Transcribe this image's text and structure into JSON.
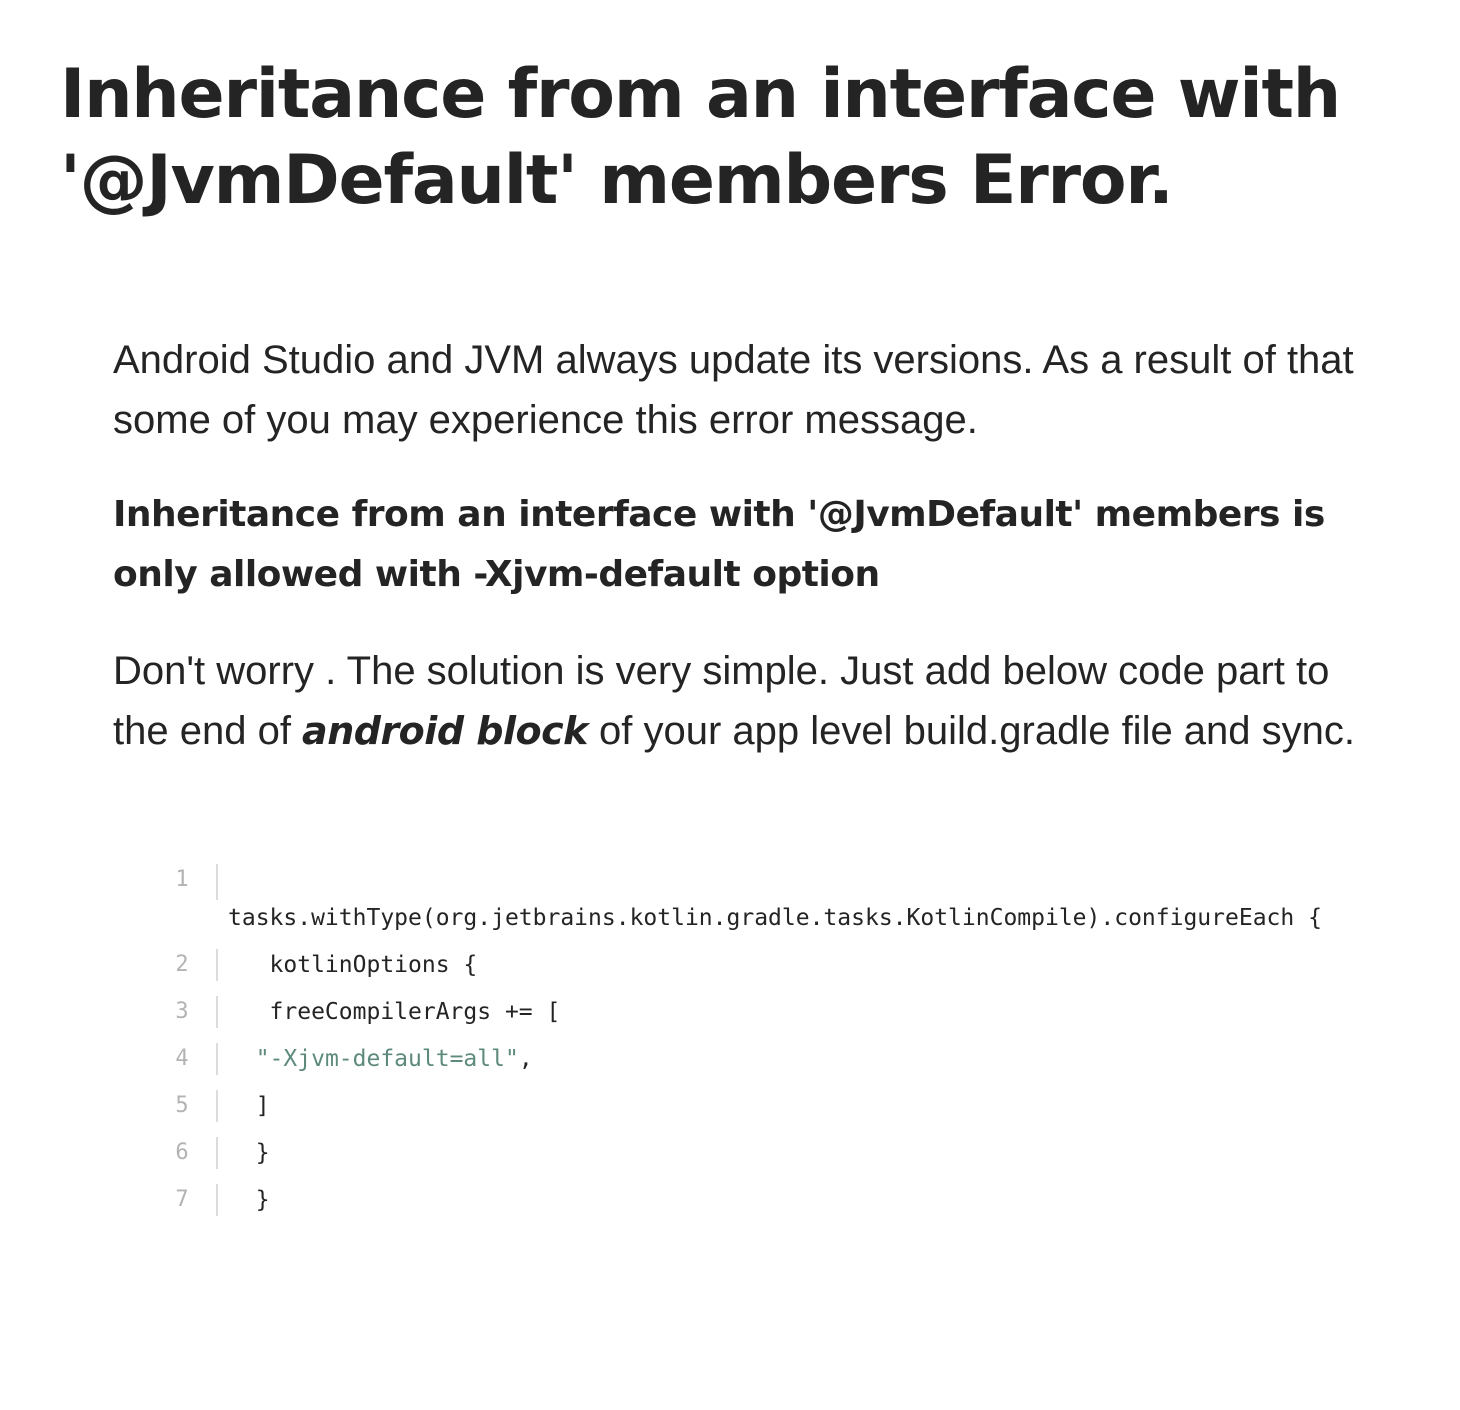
{
  "article": {
    "title": "Inheritance from an interface with '@JvmDefault' members Error.",
    "paragraphs": {
      "intro": "Android Studio and JVM always update its versions. As a result of that some of you may experience this error message.",
      "error_message": "Inheritance from an interface with '@JvmDefault' members is only allowed with -Xjvm-default option",
      "solution_part1": "Don't worry . The solution is very simple. Just add below code part to the end of ",
      "solution_emphasis": "android block",
      "solution_part2": " of your app level build.gradle file and sync."
    }
  },
  "code": {
    "lines": [
      {
        "num": "1",
        "text": "tasks.withType(org.jetbrains.kotlin.gradle.tasks.KotlinCompile).configureEach {"
      },
      {
        "num": "2",
        "text": "   kotlinOptions {"
      },
      {
        "num": "3",
        "text": "   freeCompilerArgs += ["
      },
      {
        "num": "4",
        "indent": "  ",
        "string_text": "\"-Xjvm-default=all\"",
        "suffix": ","
      },
      {
        "num": "5",
        "text": "  ]"
      },
      {
        "num": "6",
        "text": "  }"
      },
      {
        "num": "7",
        "text": "  }"
      }
    ]
  },
  "colors": {
    "text": "#242424",
    "line_number": "#b3b3b3",
    "string_literal": "#5e8a7e",
    "gutter_rule": "#dcdcdc",
    "background": "#ffffff"
  }
}
